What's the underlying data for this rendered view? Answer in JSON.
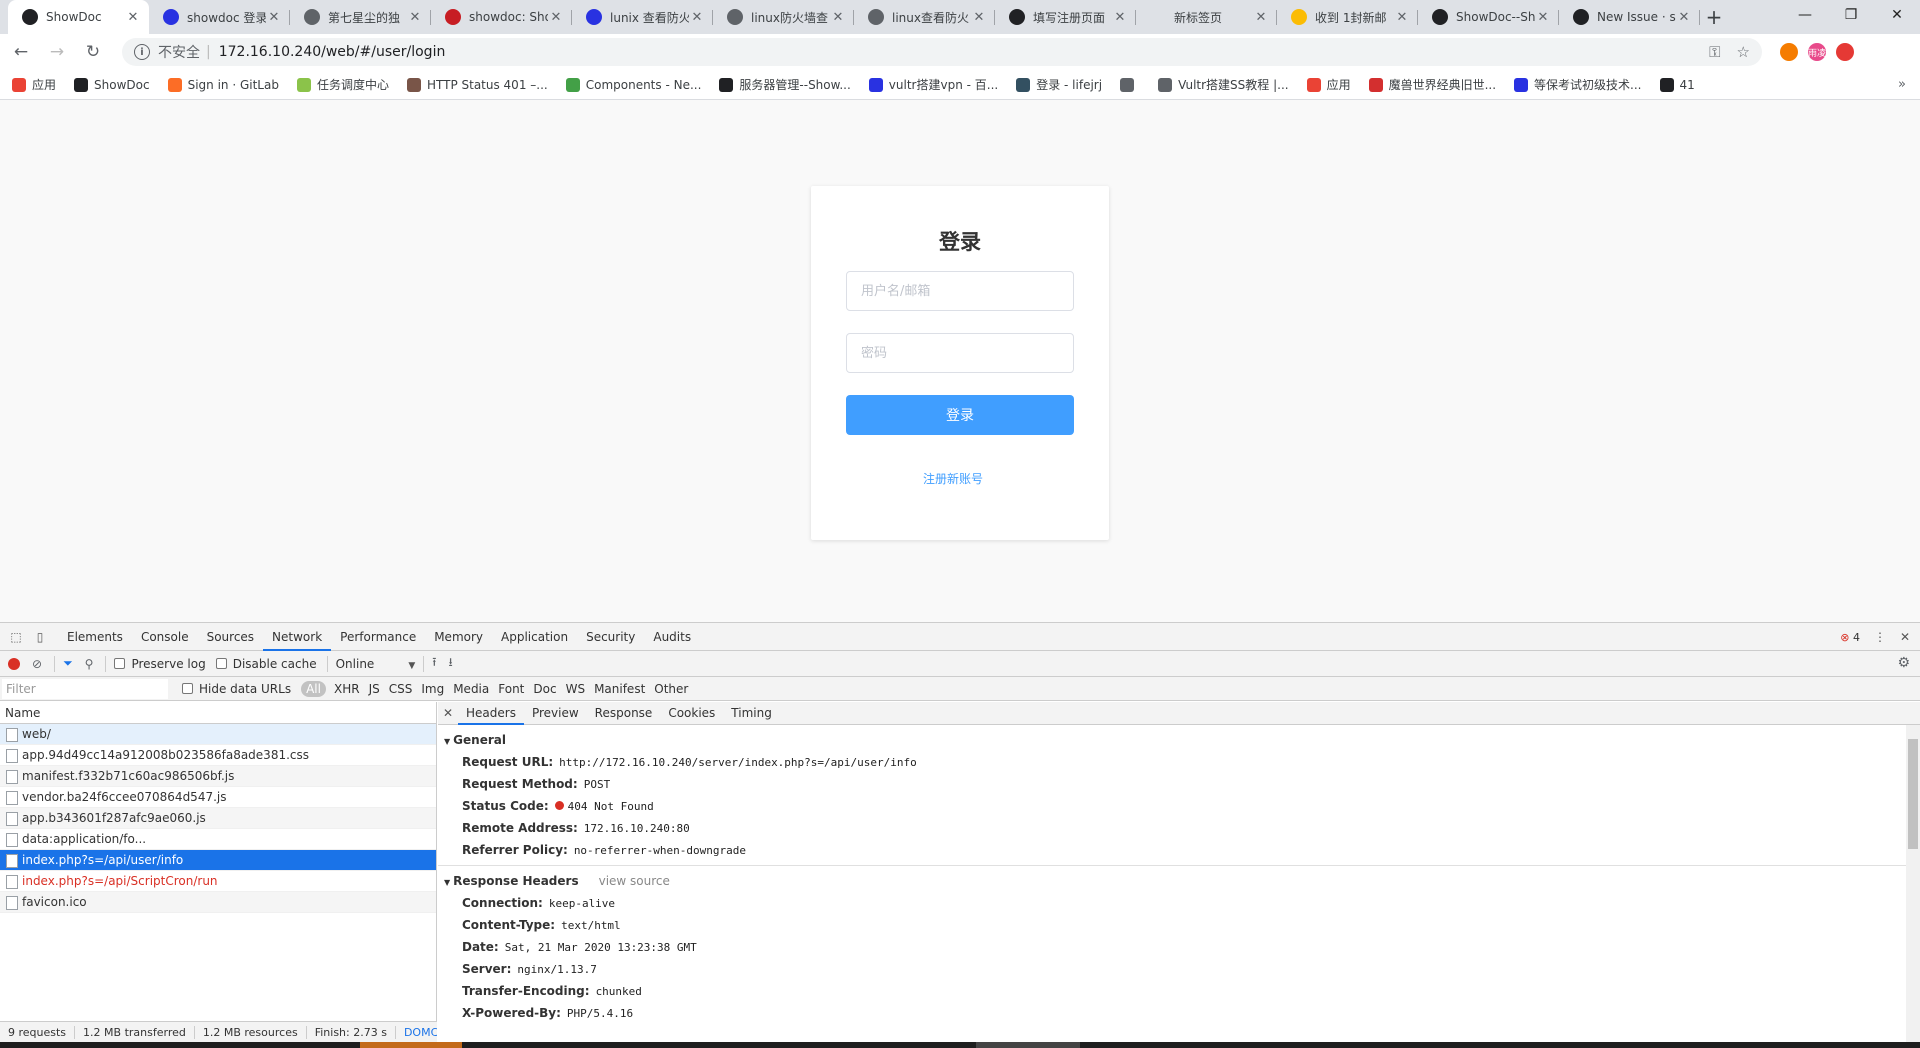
{
  "browser": {
    "tabs": [
      {
        "title": "ShowDoc",
        "favicon": "compass-icon",
        "color": "#202124",
        "active": true
      },
      {
        "title": "showdoc 登录",
        "favicon": "baidu-paw-icon",
        "color": "#2932e1"
      },
      {
        "title": "第七星尘的独",
        "favicon": "globe-icon",
        "color": "#5f6368"
      },
      {
        "title": "showdoc: Sho",
        "favicon": "gitee-icon",
        "color": "#c71d23"
      },
      {
        "title": "lunix 查看防火",
        "favicon": "baidu-paw-icon",
        "color": "#2932e1"
      },
      {
        "title": "linux防火墙查",
        "favicon": "zhihu-icon",
        "color": "#5f6368"
      },
      {
        "title": "linux查看防火",
        "favicon": "zhihu-icon",
        "color": "#5f6368"
      },
      {
        "title": "填写注册页面",
        "favicon": "github-icon",
        "color": "#202124"
      },
      {
        "title": "新标签页",
        "favicon": "",
        "color": ""
      },
      {
        "title": "收到 1封新邮",
        "favicon": "chrome-icon",
        "color": "#fbbc04"
      },
      {
        "title": "ShowDoc--Sh",
        "favicon": "compass-icon",
        "color": "#202124"
      },
      {
        "title": "New Issue · s",
        "favicon": "github-icon",
        "color": "#202124"
      }
    ],
    "new_tab": "+",
    "window_controls": {
      "minimize": "—",
      "maximize": "❐",
      "close": "✕"
    },
    "toolbar": {
      "back": "←",
      "forward": "→",
      "reload": "↻",
      "info": "i",
      "security": "不安全",
      "url": "172.16.10.240/web/#/user/login",
      "key_icon": "⚿",
      "star_icon": "☆"
    },
    "extensions": [
      {
        "name": "ext-orange-icon",
        "color": "#f57c00",
        "label": ""
      },
      {
        "name": "ext-pink-badge-icon",
        "color": "#e84a8a",
        "label": "雨凌"
      },
      {
        "name": "ext-red-icon",
        "color": "#e53935",
        "label": ""
      }
    ],
    "bookmarks": [
      {
        "label": "应用",
        "icon": "apps-grid-icon",
        "color": "#ea4335"
      },
      {
        "label": "ShowDoc",
        "icon": "compass-icon",
        "color": "#202124"
      },
      {
        "label": "Sign in · GitLab",
        "icon": "gitlab-icon",
        "color": "#fc6d26"
      },
      {
        "label": "任务调度中心",
        "icon": "cloud-icon",
        "color": "#8bc34a"
      },
      {
        "label": "HTTP Status 401 –...",
        "icon": "image-icon",
        "color": "#795548"
      },
      {
        "label": "Components - Ne...",
        "icon": "hexagon-icon",
        "color": "#43a047"
      },
      {
        "label": "服务器管理--Show...",
        "icon": "compass-icon",
        "color": "#202124"
      },
      {
        "label": "vultr搭建vpn - 百...",
        "icon": "baidu-paw-icon",
        "color": "#2932e1"
      },
      {
        "label": "登录 - lifejrj",
        "icon": "jenkins-icon",
        "color": "#335061"
      },
      {
        "label": "",
        "icon": "globe-icon",
        "color": "#5f6368"
      },
      {
        "label": "Vultr搭建SS教程 |...",
        "icon": "globe-icon",
        "color": "#5f6368"
      },
      {
        "label": "应用",
        "icon": "apps-grid-icon",
        "color": "#ea4335"
      },
      {
        "label": "魔兽世界经典旧世...",
        "icon": "game-icon",
        "color": "#d32f2f"
      },
      {
        "label": "等保考试初级技术...",
        "icon": "baidu-paw-icon",
        "color": "#2932e1"
      },
      {
        "label": "41",
        "icon": "compass-icon",
        "color": "#202124"
      }
    ],
    "bookmarks_more": "»"
  },
  "login": {
    "title": "登录",
    "username_placeholder": "用户名/邮箱",
    "password_placeholder": "密码",
    "submit": "登录",
    "register": "注册新账号",
    "accent": "#409eff"
  },
  "devtools": {
    "tabs": [
      "Elements",
      "Console",
      "Sources",
      "Network",
      "Performance",
      "Memory",
      "Application",
      "Security",
      "Audits"
    ],
    "active_tab": "Network",
    "error_count": "4",
    "close": "✕",
    "menu": "⋮",
    "network_toolbar": {
      "preserve_log": "Preserve log",
      "disable_cache": "Disable cache",
      "throttle": "Online"
    },
    "filter": {
      "placeholder": "Filter",
      "hide_data_urls": "Hide data URLs",
      "types": [
        "All",
        "XHR",
        "JS",
        "CSS",
        "Img",
        "Media",
        "Font",
        "Doc",
        "WS",
        "Manifest",
        "Other"
      ]
    },
    "request_list": {
      "header": "Name",
      "rows": [
        {
          "name": "web/",
          "state": "first"
        },
        {
          "name": "app.94d49cc14a912008b023586fa8ade381.css",
          "state": ""
        },
        {
          "name": "manifest.f332b71c60ac986506bf.js",
          "state": ""
        },
        {
          "name": "vendor.ba24f6ccee070864d547.js",
          "state": ""
        },
        {
          "name": "app.b343601f287afc9ae060.js",
          "state": ""
        },
        {
          "name": "data:application/fo...",
          "state": ""
        },
        {
          "name": "index.php?s=/api/user/info",
          "state": "selected"
        },
        {
          "name": "index.php?s=/api/ScriptCron/run",
          "state": "err"
        },
        {
          "name": "favicon.ico",
          "state": ""
        }
      ],
      "footer": {
        "requests": "9 requests",
        "transferred": "1.2 MB transferred",
        "resources": "1.2 MB resources",
        "finish": "Finish: 2.73 s",
        "dcl": "DOMCc"
      }
    },
    "detail": {
      "tabs": [
        "Headers",
        "Preview",
        "Response",
        "Cookies",
        "Timing"
      ],
      "active_tab": "Headers",
      "general": {
        "title": "General",
        "rows": [
          {
            "key": "Request URL:",
            "value": "http://172.16.10.240/server/index.php?s=/api/user/info"
          },
          {
            "key": "Request Method:",
            "value": "POST"
          },
          {
            "key": "Status Code:",
            "value": "404 Not Found",
            "status": "error"
          },
          {
            "key": "Remote Address:",
            "value": "172.16.10.240:80"
          },
          {
            "key": "Referrer Policy:",
            "value": "no-referrer-when-downgrade"
          }
        ]
      },
      "response_headers": {
        "title": "Response Headers",
        "view_source": "view source",
        "rows": [
          {
            "key": "Connection:",
            "value": "keep-alive"
          },
          {
            "key": "Content-Type:",
            "value": "text/html"
          },
          {
            "key": "Date:",
            "value": "Sat, 21 Mar 2020 13:23:38 GMT"
          },
          {
            "key": "Server:",
            "value": "nginx/1.13.7"
          },
          {
            "key": "Transfer-Encoding:",
            "value": "chunked"
          },
          {
            "key": "X-Powered-By:",
            "value": "PHP/5.4.16"
          }
        ]
      }
    }
  }
}
